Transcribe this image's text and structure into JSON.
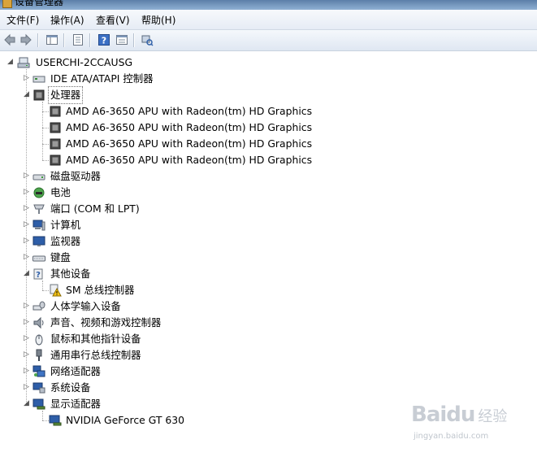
{
  "window": {
    "title": "设备管理器"
  },
  "menu": [
    "文件(F)",
    "操作(A)",
    "查看(V)",
    "帮助(H)"
  ],
  "toolbar": {
    "buttons": [
      "back-icon",
      "forward-icon",
      "show-hide-tree-icon",
      "properties-icon",
      "help-icon",
      "details-icon",
      "scan-hardware-icon"
    ]
  },
  "tree": {
    "root": "USERCHI-2CCAUSG",
    "categories": [
      {
        "label": "IDE ATA/ATAPI 控制器",
        "icon": "ide-controller-icon",
        "expanded": false,
        "children": []
      },
      {
        "label": "处理器",
        "icon": "processor-icon",
        "expanded": true,
        "selected": true,
        "children": [
          {
            "label": "AMD A6-3650 APU with Radeon(tm) HD Graphics",
            "icon": "processor-icon"
          },
          {
            "label": "AMD A6-3650 APU with Radeon(tm) HD Graphics",
            "icon": "processor-icon"
          },
          {
            "label": "AMD A6-3650 APU with Radeon(tm) HD Graphics",
            "icon": "processor-icon"
          },
          {
            "label": "AMD A6-3650 APU with Radeon(tm) HD Graphics",
            "icon": "processor-icon"
          }
        ]
      },
      {
        "label": "磁盘驱动器",
        "icon": "disk-drive-icon",
        "expanded": false,
        "children": []
      },
      {
        "label": "电池",
        "icon": "battery-icon",
        "expanded": false,
        "children": []
      },
      {
        "label": "端口 (COM 和 LPT)",
        "icon": "port-icon",
        "expanded": false,
        "children": []
      },
      {
        "label": "计算机",
        "icon": "computer-icon",
        "expanded": false,
        "children": []
      },
      {
        "label": "监视器",
        "icon": "monitor-icon",
        "expanded": false,
        "children": []
      },
      {
        "label": "键盘",
        "icon": "keyboard-icon",
        "expanded": false,
        "children": []
      },
      {
        "label": "其他设备",
        "icon": "other-devices-icon",
        "expanded": true,
        "children": [
          {
            "label": "SM 总线控制器",
            "icon": "warning-device-icon"
          }
        ]
      },
      {
        "label": "人体学输入设备",
        "icon": "hid-icon",
        "expanded": false,
        "children": []
      },
      {
        "label": "声音、视频和游戏控制器",
        "icon": "speaker-icon",
        "expanded": false,
        "children": []
      },
      {
        "label": "鼠标和其他指针设备",
        "icon": "mouse-icon",
        "expanded": false,
        "children": []
      },
      {
        "label": "通用串行总线控制器",
        "icon": "usb-icon",
        "expanded": false,
        "children": []
      },
      {
        "label": "网络适配器",
        "icon": "network-adapter-icon",
        "expanded": false,
        "children": []
      },
      {
        "label": "系统设备",
        "icon": "system-device-icon",
        "expanded": false,
        "children": []
      },
      {
        "label": "显示适配器",
        "icon": "display-adapter-icon",
        "expanded": true,
        "children": [
          {
            "label": "NVIDIA GeForce GT 630",
            "icon": "display-adapter-icon"
          }
        ]
      }
    ]
  },
  "watermark": {
    "brand": "Baidu",
    "suffix": "经验",
    "url": "jingyan.baidu.com"
  }
}
